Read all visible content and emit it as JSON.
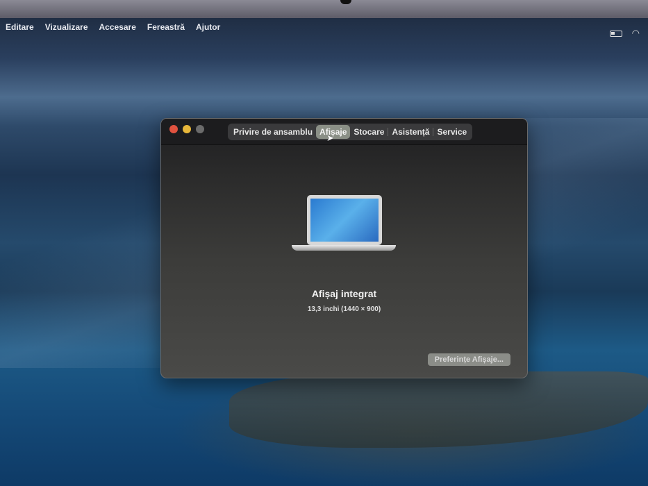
{
  "menubar": {
    "items": [
      "Editare",
      "Vizualizare",
      "Accesare",
      "Fereastră",
      "Ajutor"
    ]
  },
  "window": {
    "tabs": [
      "Privire de ansamblu",
      "Afișaje",
      "Stocare",
      "Asistență",
      "Service"
    ],
    "active_tab": "Afișaje",
    "display_name": "Afișaj integrat",
    "display_spec": "13,3 inchi (1440 × 900)",
    "preferences_button": "Preferințe Afișaje..."
  },
  "colors": {
    "close": "#e0523f",
    "minimize": "#e7b73a",
    "zoom": "#6b6b6b"
  }
}
